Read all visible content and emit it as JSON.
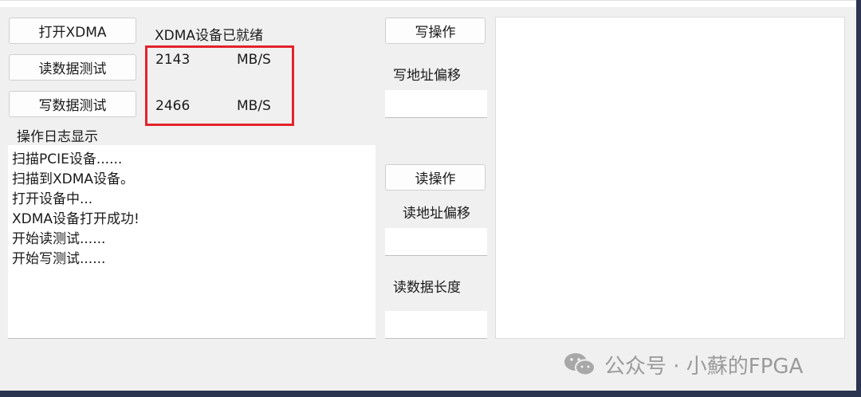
{
  "buttons": {
    "open_xdma": "打开XDMA",
    "read_test": "读数据测试",
    "write_test": "写数据测试",
    "write_op": "写操作",
    "read_op": "读操作"
  },
  "status": {
    "device_ready": "XDMA设备已就绪",
    "read_speed": "2143",
    "read_unit": "MB/S",
    "write_speed": "2466",
    "write_unit": "MB/S"
  },
  "log": {
    "title": "操作日志显示",
    "lines": [
      "扫描PCIE设备......",
      "扫描到XDMA设备。",
      "打开设备中...",
      "XDMA设备打开成功!",
      "开始读测试......",
      "开始写测试......"
    ]
  },
  "fields": {
    "write_addr_label": "写地址偏移",
    "write_addr_value": "",
    "read_addr_label": "读地址偏移",
    "read_addr_value": "",
    "read_len_label": "读数据长度",
    "read_len_value": ""
  },
  "watermark": {
    "icon": "wechat-icon",
    "text": "公众号 · 小蘇的FPGA"
  },
  "colors": {
    "highlight_border": "#e2232b",
    "window_bg": "#f0f0f0",
    "desktop_bg": "#2b3550"
  }
}
